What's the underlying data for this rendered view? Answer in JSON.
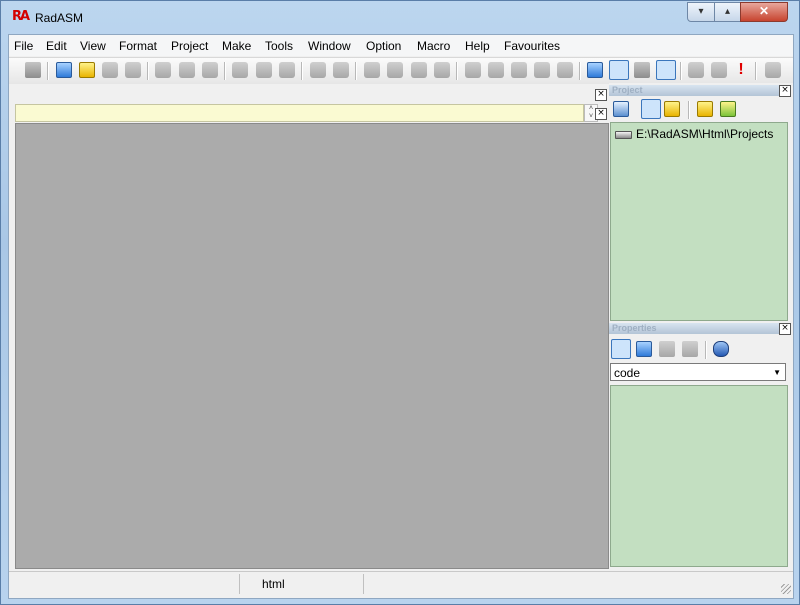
{
  "window": {
    "title": "RadASM",
    "app_icon_glyph": "RA"
  },
  "window_controls": {
    "minimize": "▾",
    "maximize": "▴",
    "close": "✕"
  },
  "menu": [
    "File",
    "Edit",
    "View",
    "Format",
    "Project",
    "Make",
    "Tools",
    "Window",
    "Option",
    "Macro",
    "Help",
    "Favourites"
  ],
  "toolbar_icons": [
    "print-icon",
    "new-file-icon",
    "open-file-icon",
    "save-icon",
    "save-all-icon",
    "cut-icon",
    "copy-icon",
    "paste-icon",
    "undo-icon",
    "redo-icon",
    "delete-icon",
    "find-icon",
    "replace-icon",
    "bookmark-toggle-icon",
    "bookmark-next-icon",
    "bookmark-prev-icon",
    "bookmark-clear-icon",
    "block-copy-icon",
    "indent-icon",
    "outdent-icon",
    "comment-icon",
    "uncomment-icon",
    "project-browser-icon",
    "properties-icon",
    "tools-icon",
    "output-icon",
    "assemble-icon",
    "link-icon",
    "run-icon",
    "exit-icon"
  ],
  "project_panel": {
    "caption": "Project",
    "path": "E:\\RadASM\\Html\\Projects"
  },
  "properties_panel": {
    "caption": "Properties",
    "selected_type": "code"
  },
  "spin": {
    "up": "˄",
    "down": "˅"
  },
  "close_glyph": "×",
  "dropdown_arrow": "▼",
  "statusbar": {
    "cell_1": "",
    "cell_2": "html"
  },
  "colors": {
    "panel_green": "#c3dfc1",
    "mdi_gray": "#ababab",
    "hint_yellow": "#fafad2",
    "title_red": "#d40000"
  }
}
